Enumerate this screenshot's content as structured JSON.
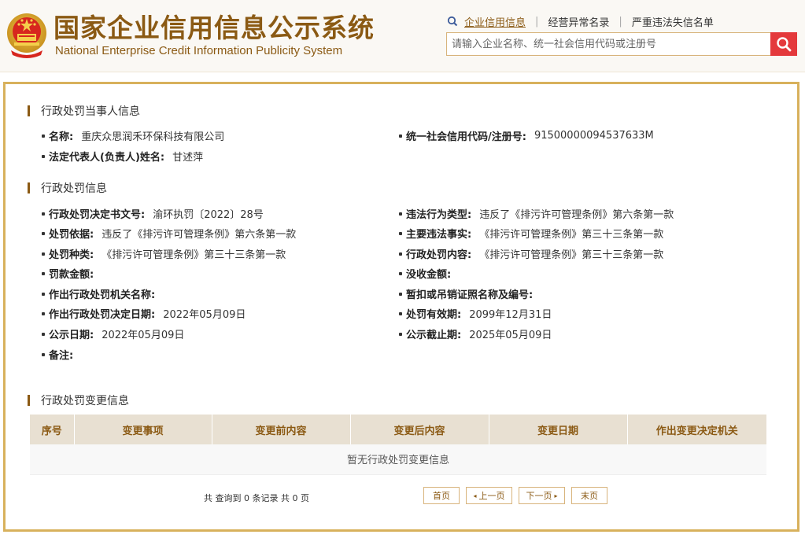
{
  "header": {
    "title_cn": "国家企业信用信息公示系统",
    "title_en": "National Enterprise Credit Information Publicity System",
    "nav": [
      {
        "label": "企业信用信息",
        "active": true
      },
      {
        "label": "经营异常名录",
        "active": false
      },
      {
        "label": "严重违法失信名单",
        "active": false
      }
    ],
    "search_placeholder": "请输入企业名称、统一社会信用代码或注册号",
    "icons": {
      "nav_search": "search-icon",
      "search_button": "search-icon",
      "emblem": "national-emblem-icon"
    },
    "colors": {
      "brand": "#8b5a14",
      "search_button": "#e4393c",
      "frame": "#d8b15c"
    }
  },
  "party": {
    "title": "行政处罚当事人信息",
    "name_label": "名称:",
    "name_value": "重庆众思润禾环保科技有限公司",
    "credit_code_label": "统一社会信用代码/注册号:",
    "credit_code_value": "91500000094537633M",
    "legal_rep_label": "法定代表人(负责人)姓名:",
    "legal_rep_value": "甘述萍"
  },
  "penalty": {
    "title": "行政处罚信息",
    "left": [
      {
        "label": "行政处罚决定书文号:",
        "value": "渝环执罚〔2022〕28号"
      },
      {
        "label": "处罚依据:",
        "value": "违反了《排污许可管理条例》第六条第一款"
      },
      {
        "label": "处罚种类:",
        "value": "《排污许可管理条例》第三十三条第一款"
      },
      {
        "label": "罚款金额:",
        "value": ""
      },
      {
        "label": "作出行政处罚机关名称:",
        "value": ""
      },
      {
        "label": "作出行政处罚决定日期:",
        "value": "2022年05月09日"
      },
      {
        "label": "公示日期:",
        "value": "2022年05月09日"
      },
      {
        "label": "备注:",
        "value": ""
      }
    ],
    "right": [
      {
        "label": "违法行为类型:",
        "value": "违反了《排污许可管理条例》第六条第一款"
      },
      {
        "label": "主要违法事实:",
        "value": "《排污许可管理条例》第三十三条第一款"
      },
      {
        "label": "行政处罚内容:",
        "value": "《排污许可管理条例》第三十三条第一款"
      },
      {
        "label": "没收金额:",
        "value": ""
      },
      {
        "label": "暂扣或吊销证照名称及编号:",
        "value": ""
      },
      {
        "label": "处罚有效期:",
        "value": "2099年12月31日"
      },
      {
        "label": "公示截止期:",
        "value": "2025年05月09日"
      }
    ]
  },
  "changes": {
    "title": "行政处罚变更信息",
    "columns": [
      "序号",
      "变更事项",
      "变更前内容",
      "变更后内容",
      "变更日期",
      "作出变更决定机关"
    ],
    "empty_text": "暂无行政处罚变更信息",
    "count_text": "共 查询到 0 条记录 共 0 页",
    "pager": {
      "first": "首页",
      "prev": "上一页",
      "next": "下一页",
      "last": "末页"
    }
  }
}
